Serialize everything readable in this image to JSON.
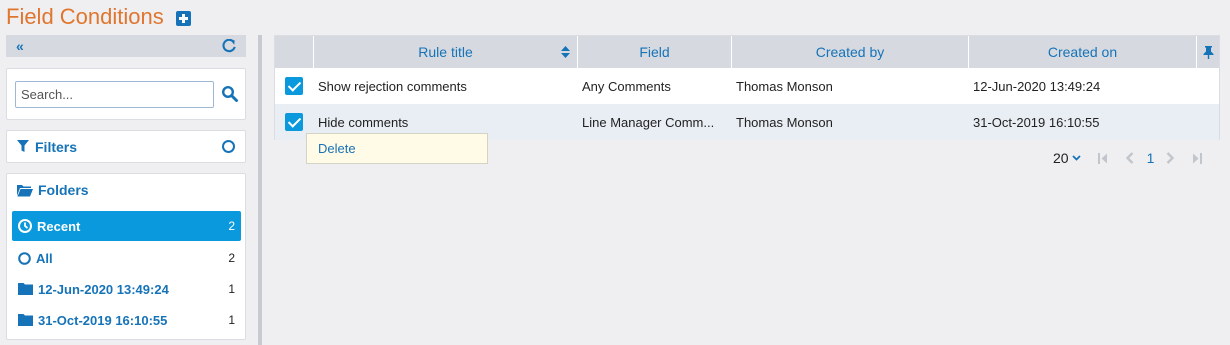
{
  "header": {
    "title": "Field Conditions"
  },
  "sidebar": {
    "search": {
      "placeholder": "Search..."
    },
    "filters_label": "Filters",
    "folders_label": "Folders",
    "folders": [
      {
        "label": "Recent",
        "count": "2",
        "icon": "clock-icon"
      },
      {
        "label": "All",
        "count": "2",
        "icon": "circle-icon"
      },
      {
        "label": "12-Jun-2020 13:49:24",
        "count": "1",
        "icon": "folder-icon"
      },
      {
        "label": "31-Oct-2019 16:10:55",
        "count": "1",
        "icon": "folder-icon"
      }
    ]
  },
  "grid": {
    "columns": [
      "Rule title",
      "Field",
      "Created by",
      "Created on"
    ],
    "rows": [
      {
        "title": "Show rejection comments",
        "field": "Any Comments",
        "created_by": "Thomas Monson",
        "created_on": "12-Jun-2020 13:49:24",
        "checked": true
      },
      {
        "title": "Hide comments",
        "field": "Line Manager Comm...",
        "created_by": "Thomas Monson",
        "created_on": "31-Oct-2019 16:10:55",
        "checked": true
      }
    ]
  },
  "context_menu": {
    "delete_label": "Delete"
  },
  "pager": {
    "page_size": "20",
    "current_page": "1"
  },
  "colors": {
    "accent": "#1673b8",
    "title": "#e0762e",
    "active": "#0a99dd"
  }
}
